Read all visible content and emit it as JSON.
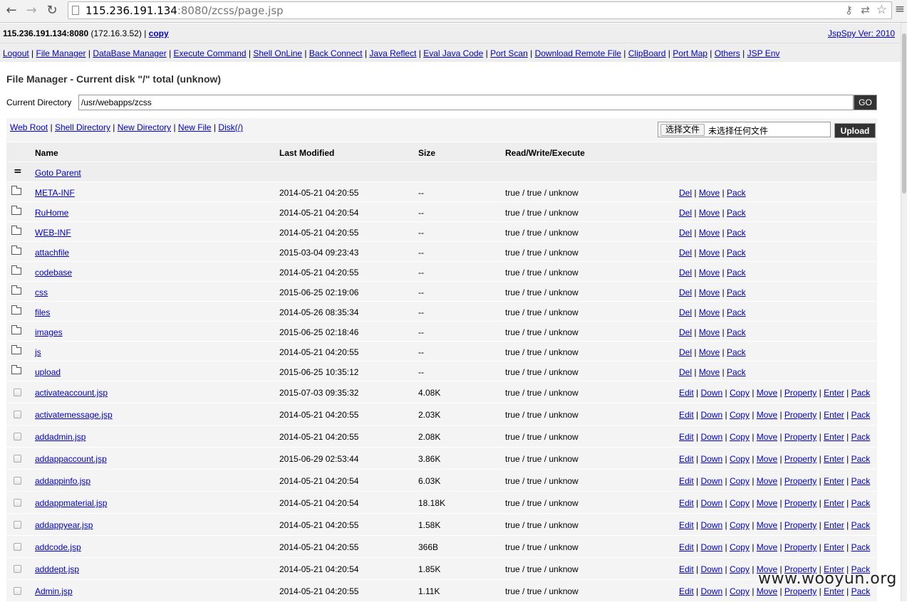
{
  "browser": {
    "url_host": "115.236.191.134",
    "url_rest": ":8080/zcss/page.jsp"
  },
  "header": {
    "host": "115.236.191.134:8080",
    "ip": "(172.16.3.52)",
    "copy_label": "copy",
    "version": "JspSpy Ver: 2010"
  },
  "nav": {
    "items": [
      "Logout",
      "File Manager",
      "DataBase Manager",
      "Execute Command",
      "Shell OnLine",
      "Back Connect",
      "Java Reflect",
      "Eval Java Code",
      "Port Scan",
      "Download Remote File",
      "ClipBoard",
      "Port Map",
      "Others",
      "JSP Env"
    ]
  },
  "file_manager": {
    "title": "File Manager - Current disk \"/\" total (unknow)",
    "current_directory_label": "Current Directory",
    "current_directory_value": "/usr/webapps/zcss",
    "go_label": "GO",
    "quick_links": [
      "Web Root",
      "Shell Directory",
      "New Directory",
      "New File",
      "Disk(/)"
    ],
    "choose_file_label": "选择文件",
    "no_file_text": "未选择任何文件",
    "upload_label": "Upload"
  },
  "table": {
    "headers": {
      "name": "Name",
      "modified": "Last Modified",
      "size": "Size",
      "rwx": "Read/Write/Execute"
    },
    "goto_parent": "Goto Parent",
    "dir_actions": [
      "Del",
      "Move",
      "Pack"
    ],
    "file_actions": [
      "Edit",
      "Down",
      "Copy",
      "Move",
      "Property",
      "Enter",
      "Pack"
    ],
    "directories": [
      {
        "name": "META-INF",
        "modified": "2014-05-21 04:20:55",
        "size": "--",
        "rwx": "true / true / unknow"
      },
      {
        "name": "RuHome",
        "modified": "2014-05-21 04:20:54",
        "size": "--",
        "rwx": "true / true / unknow"
      },
      {
        "name": "WEB-INF",
        "modified": "2014-05-21 04:20:55",
        "size": "--",
        "rwx": "true / true / unknow"
      },
      {
        "name": "attachfile",
        "modified": "2015-03-04 09:23:43",
        "size": "--",
        "rwx": "true / true / unknow"
      },
      {
        "name": "codebase",
        "modified": "2014-05-21 04:20:55",
        "size": "--",
        "rwx": "true / true / unknow"
      },
      {
        "name": "css",
        "modified": "2015-06-25 02:19:06",
        "size": "--",
        "rwx": "true / true / unknow"
      },
      {
        "name": "files",
        "modified": "2014-05-26 08:35:34",
        "size": "--",
        "rwx": "true / true / unknow"
      },
      {
        "name": "images",
        "modified": "2015-06-25 02:18:46",
        "size": "--",
        "rwx": "true / true / unknow"
      },
      {
        "name": "js",
        "modified": "2014-05-21 04:20:55",
        "size": "--",
        "rwx": "true / true / unknow"
      },
      {
        "name": "upload",
        "modified": "2015-06-25 10:35:12",
        "size": "--",
        "rwx": "true / true / unknow"
      }
    ],
    "files": [
      {
        "name": "activateaccount.jsp",
        "modified": "2015-07-03 09:35:32",
        "size": "4.08K",
        "rwx": "true / true / unknow"
      },
      {
        "name": "activatemessage.jsp",
        "modified": "2014-05-21 04:20:55",
        "size": "2.03K",
        "rwx": "true / true / unknow"
      },
      {
        "name": "addadmin.jsp",
        "modified": "2014-05-21 04:20:55",
        "size": "2.08K",
        "rwx": "true / true / unknow"
      },
      {
        "name": "addappaccount.jsp",
        "modified": "2015-06-29 02:53:44",
        "size": "3.86K",
        "rwx": "true / true / unknow"
      },
      {
        "name": "addappinfo.jsp",
        "modified": "2014-05-21 04:20:54",
        "size": "6.03K",
        "rwx": "true / true / unknow"
      },
      {
        "name": "addappmaterial.jsp",
        "modified": "2014-05-21 04:20:54",
        "size": "18.18K",
        "rwx": "true / true / unknow"
      },
      {
        "name": "addappyear.jsp",
        "modified": "2014-05-21 04:20:55",
        "size": "1.58K",
        "rwx": "true / true / unknow"
      },
      {
        "name": "addcode.jsp",
        "modified": "2014-05-21 04:20:55",
        "size": "366B",
        "rwx": "true / true / unknow"
      },
      {
        "name": "adddept.jsp",
        "modified": "2014-05-21 04:20:54",
        "size": "1.85K",
        "rwx": "true / true / unknow"
      },
      {
        "name": "Admin.jsp",
        "modified": "2014-05-21 04:20:55",
        "size": "1.11K",
        "rwx": "true / true / unknow"
      }
    ]
  },
  "watermark": "www.wooyun.org"
}
